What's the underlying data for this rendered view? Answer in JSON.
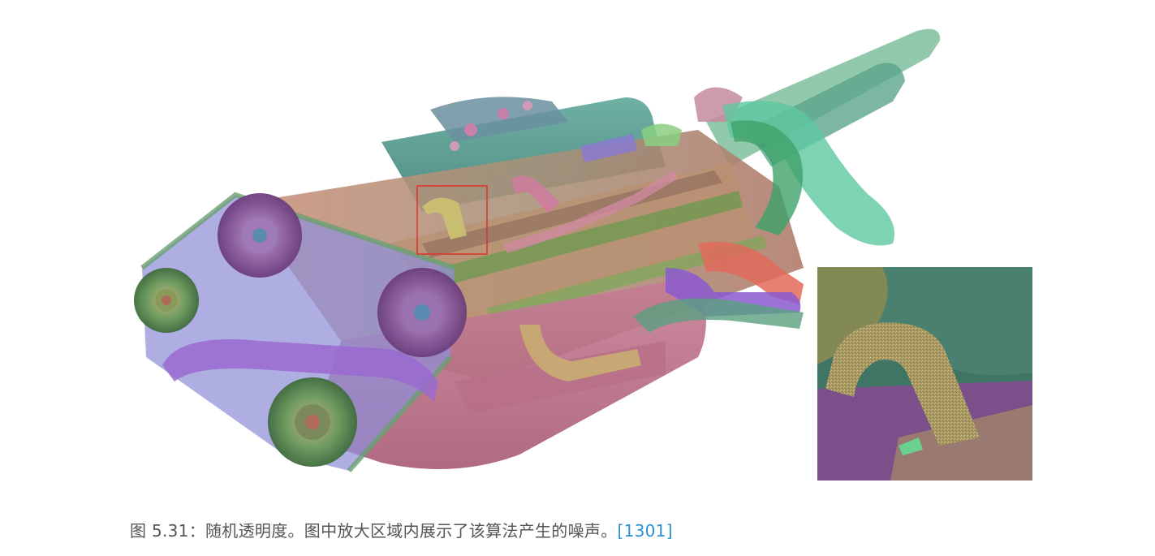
{
  "caption": {
    "text": "图 5.31：随机透明度。图中放大区域内展示了该算法产生的噪声。",
    "citation": "[1301]"
  },
  "colors": {
    "caption_text": "#555555",
    "citation": "#2b8fd0",
    "zoom_box": "#e0312c"
  }
}
